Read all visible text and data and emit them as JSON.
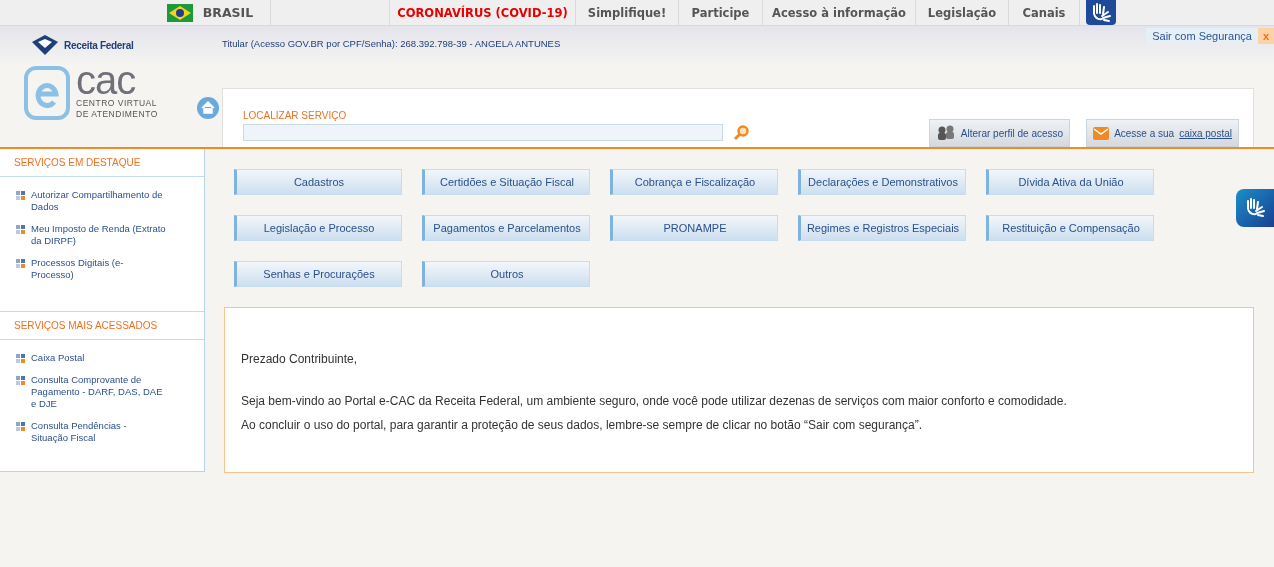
{
  "gov_bar": {
    "country": "BRASIL",
    "links": [
      {
        "label": "CORONAVÍRUS (COVID-19)",
        "kind": "alert"
      },
      {
        "label": "Simplifique!",
        "kind": "normal"
      },
      {
        "label": "Participe",
        "kind": "normal"
      },
      {
        "label": "Acesso à informação",
        "kind": "normal"
      },
      {
        "label": "Legislação",
        "kind": "normal"
      },
      {
        "label": "Canais",
        "kind": "normal"
      }
    ]
  },
  "header": {
    "agency": "Receita Federal",
    "logo_text": "cac",
    "logo_subtitle": "CENTRO VIRTUAL DE ATENDIMENTO",
    "user_line": "Titular (Acesso GOV.BR por CPF/Senha): 268.392.798-39 - ANGELA ANTUNES",
    "logout": "Sair com Segurança",
    "logout_close": "x"
  },
  "search": {
    "label": "LOCALIZAR SERVIÇO"
  },
  "actions": {
    "profile": "Alterar perfil de acesso",
    "mailbox_prefix": "Acesse a sua",
    "mailbox_link": "caixa postal"
  },
  "sidebar": [
    {
      "title": "SERVIÇOS EM DESTAQUE",
      "items": [
        "Autorizar Compartilhamento de Dados",
        "Meu Imposto de Renda (Extrato da DIRPF)",
        "Processos Digitais (e-Processo)"
      ]
    },
    {
      "title": "SERVIÇOS MAIS ACESSADOS",
      "items": [
        "Caixa Postal",
        "Consulta Comprovante de Pagamento - DARF, DAS, DAE e DJE",
        "Consulta Pendências - Situação Fiscal"
      ]
    }
  ],
  "categories": [
    "Cadastros",
    "Certidões e Situação Fiscal",
    "Cobrança e Fiscalização",
    "Declarações e Demonstrativos",
    "Dívida Ativa da União",
    "Legislação e Processo",
    "Pagamentos e Parcelamentos",
    "PRONAMPE",
    "Regimes e Registros Especiais",
    "Restituição e Compensação",
    "Senhas e Procurações",
    "Outros"
  ],
  "welcome": {
    "greeting": "Prezado Contribuinte,",
    "paragraphs": [
      "Seja bem-vindo ao Portal e-CAC da Receita Federal, um ambiente seguro, onde você pode utilizar dezenas de serviços com maior conforto e comodidade.",
      "Ao concluir o uso do portal, para garantir a proteção de seus dados, lembre-se sempre de clicar no botão “Sair com segurança”."
    ]
  }
}
